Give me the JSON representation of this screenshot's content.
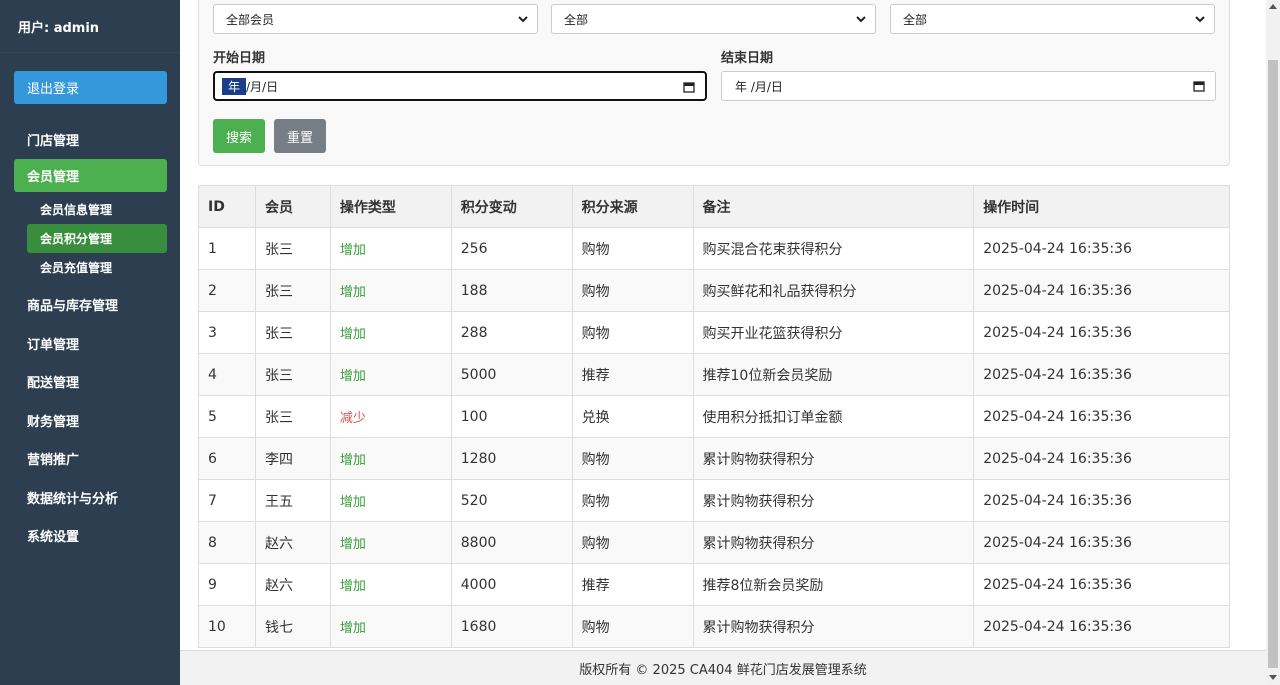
{
  "sidebar": {
    "user_label": "用户: admin",
    "logout_label": "退出登录",
    "menu": [
      {
        "label": "门店管理"
      },
      {
        "label": "会员管理"
      },
      {
        "label": "商品与库存管理"
      },
      {
        "label": "订单管理"
      },
      {
        "label": "配送管理"
      },
      {
        "label": "财务管理"
      },
      {
        "label": "营销推广"
      },
      {
        "label": "数据统计与分析"
      },
      {
        "label": "系统设置"
      }
    ],
    "submenu": [
      {
        "label": "会员信息管理"
      },
      {
        "label": "会员积分管理"
      },
      {
        "label": "会员充值管理"
      }
    ]
  },
  "filters": {
    "member_select": "全部会员",
    "type_select": "全部",
    "source_select": "全部",
    "start_label": "开始日期",
    "end_label": "结束日期",
    "start_value_year": "年",
    "start_value_rest": "/月/日",
    "end_value": "年 /月/日",
    "search_label": "搜索",
    "reset_label": "重置"
  },
  "table": {
    "headers": [
      "ID",
      "会员",
      "操作类型",
      "积分变动",
      "积分来源",
      "备注",
      "操作时间"
    ],
    "rows": [
      {
        "id": "1",
        "member": "张三",
        "type": "增加",
        "points": "256",
        "source": "购物",
        "note": "购买混合花束获得积分",
        "time": "2025-04-24 16:35:36"
      },
      {
        "id": "2",
        "member": "张三",
        "type": "增加",
        "points": "188",
        "source": "购物",
        "note": "购买鲜花和礼品获得积分",
        "time": "2025-04-24 16:35:36"
      },
      {
        "id": "3",
        "member": "张三",
        "type": "增加",
        "points": "288",
        "source": "购物",
        "note": "购买开业花篮获得积分",
        "time": "2025-04-24 16:35:36"
      },
      {
        "id": "4",
        "member": "张三",
        "type": "增加",
        "points": "5000",
        "source": "推荐",
        "note": "推荐10位新会员奖励",
        "time": "2025-04-24 16:35:36"
      },
      {
        "id": "5",
        "member": "张三",
        "type": "减少",
        "points": "100",
        "source": "兑换",
        "note": "使用积分抵扣订单金额",
        "time": "2025-04-24 16:35:36"
      },
      {
        "id": "6",
        "member": "李四",
        "type": "增加",
        "points": "1280",
        "source": "购物",
        "note": "累计购物获得积分",
        "time": "2025-04-24 16:35:36"
      },
      {
        "id": "7",
        "member": "王五",
        "type": "增加",
        "points": "520",
        "source": "购物",
        "note": "累计购物获得积分",
        "time": "2025-04-24 16:35:36"
      },
      {
        "id": "8",
        "member": "赵六",
        "type": "增加",
        "points": "8800",
        "source": "购物",
        "note": "累计购物获得积分",
        "time": "2025-04-24 16:35:36"
      },
      {
        "id": "9",
        "member": "赵六",
        "type": "增加",
        "points": "4000",
        "source": "推荐",
        "note": "推荐8位新会员奖励",
        "time": "2025-04-24 16:35:36"
      },
      {
        "id": "10",
        "member": "钱七",
        "type": "增加",
        "points": "1680",
        "source": "购物",
        "note": "累计购物获得积分",
        "time": "2025-04-24 16:35:36"
      }
    ]
  },
  "footer": {
    "text": "版权所有 © 2025 CA404 鲜花门店发展管理系统"
  },
  "colors": {
    "sidebar_bg": "#2c3e50",
    "logout_btn": "#3498db",
    "active_menu": "#4caf50",
    "active_sub": "#388e3c",
    "increase": "#3a9d3a",
    "decrease": "#d9534f"
  }
}
